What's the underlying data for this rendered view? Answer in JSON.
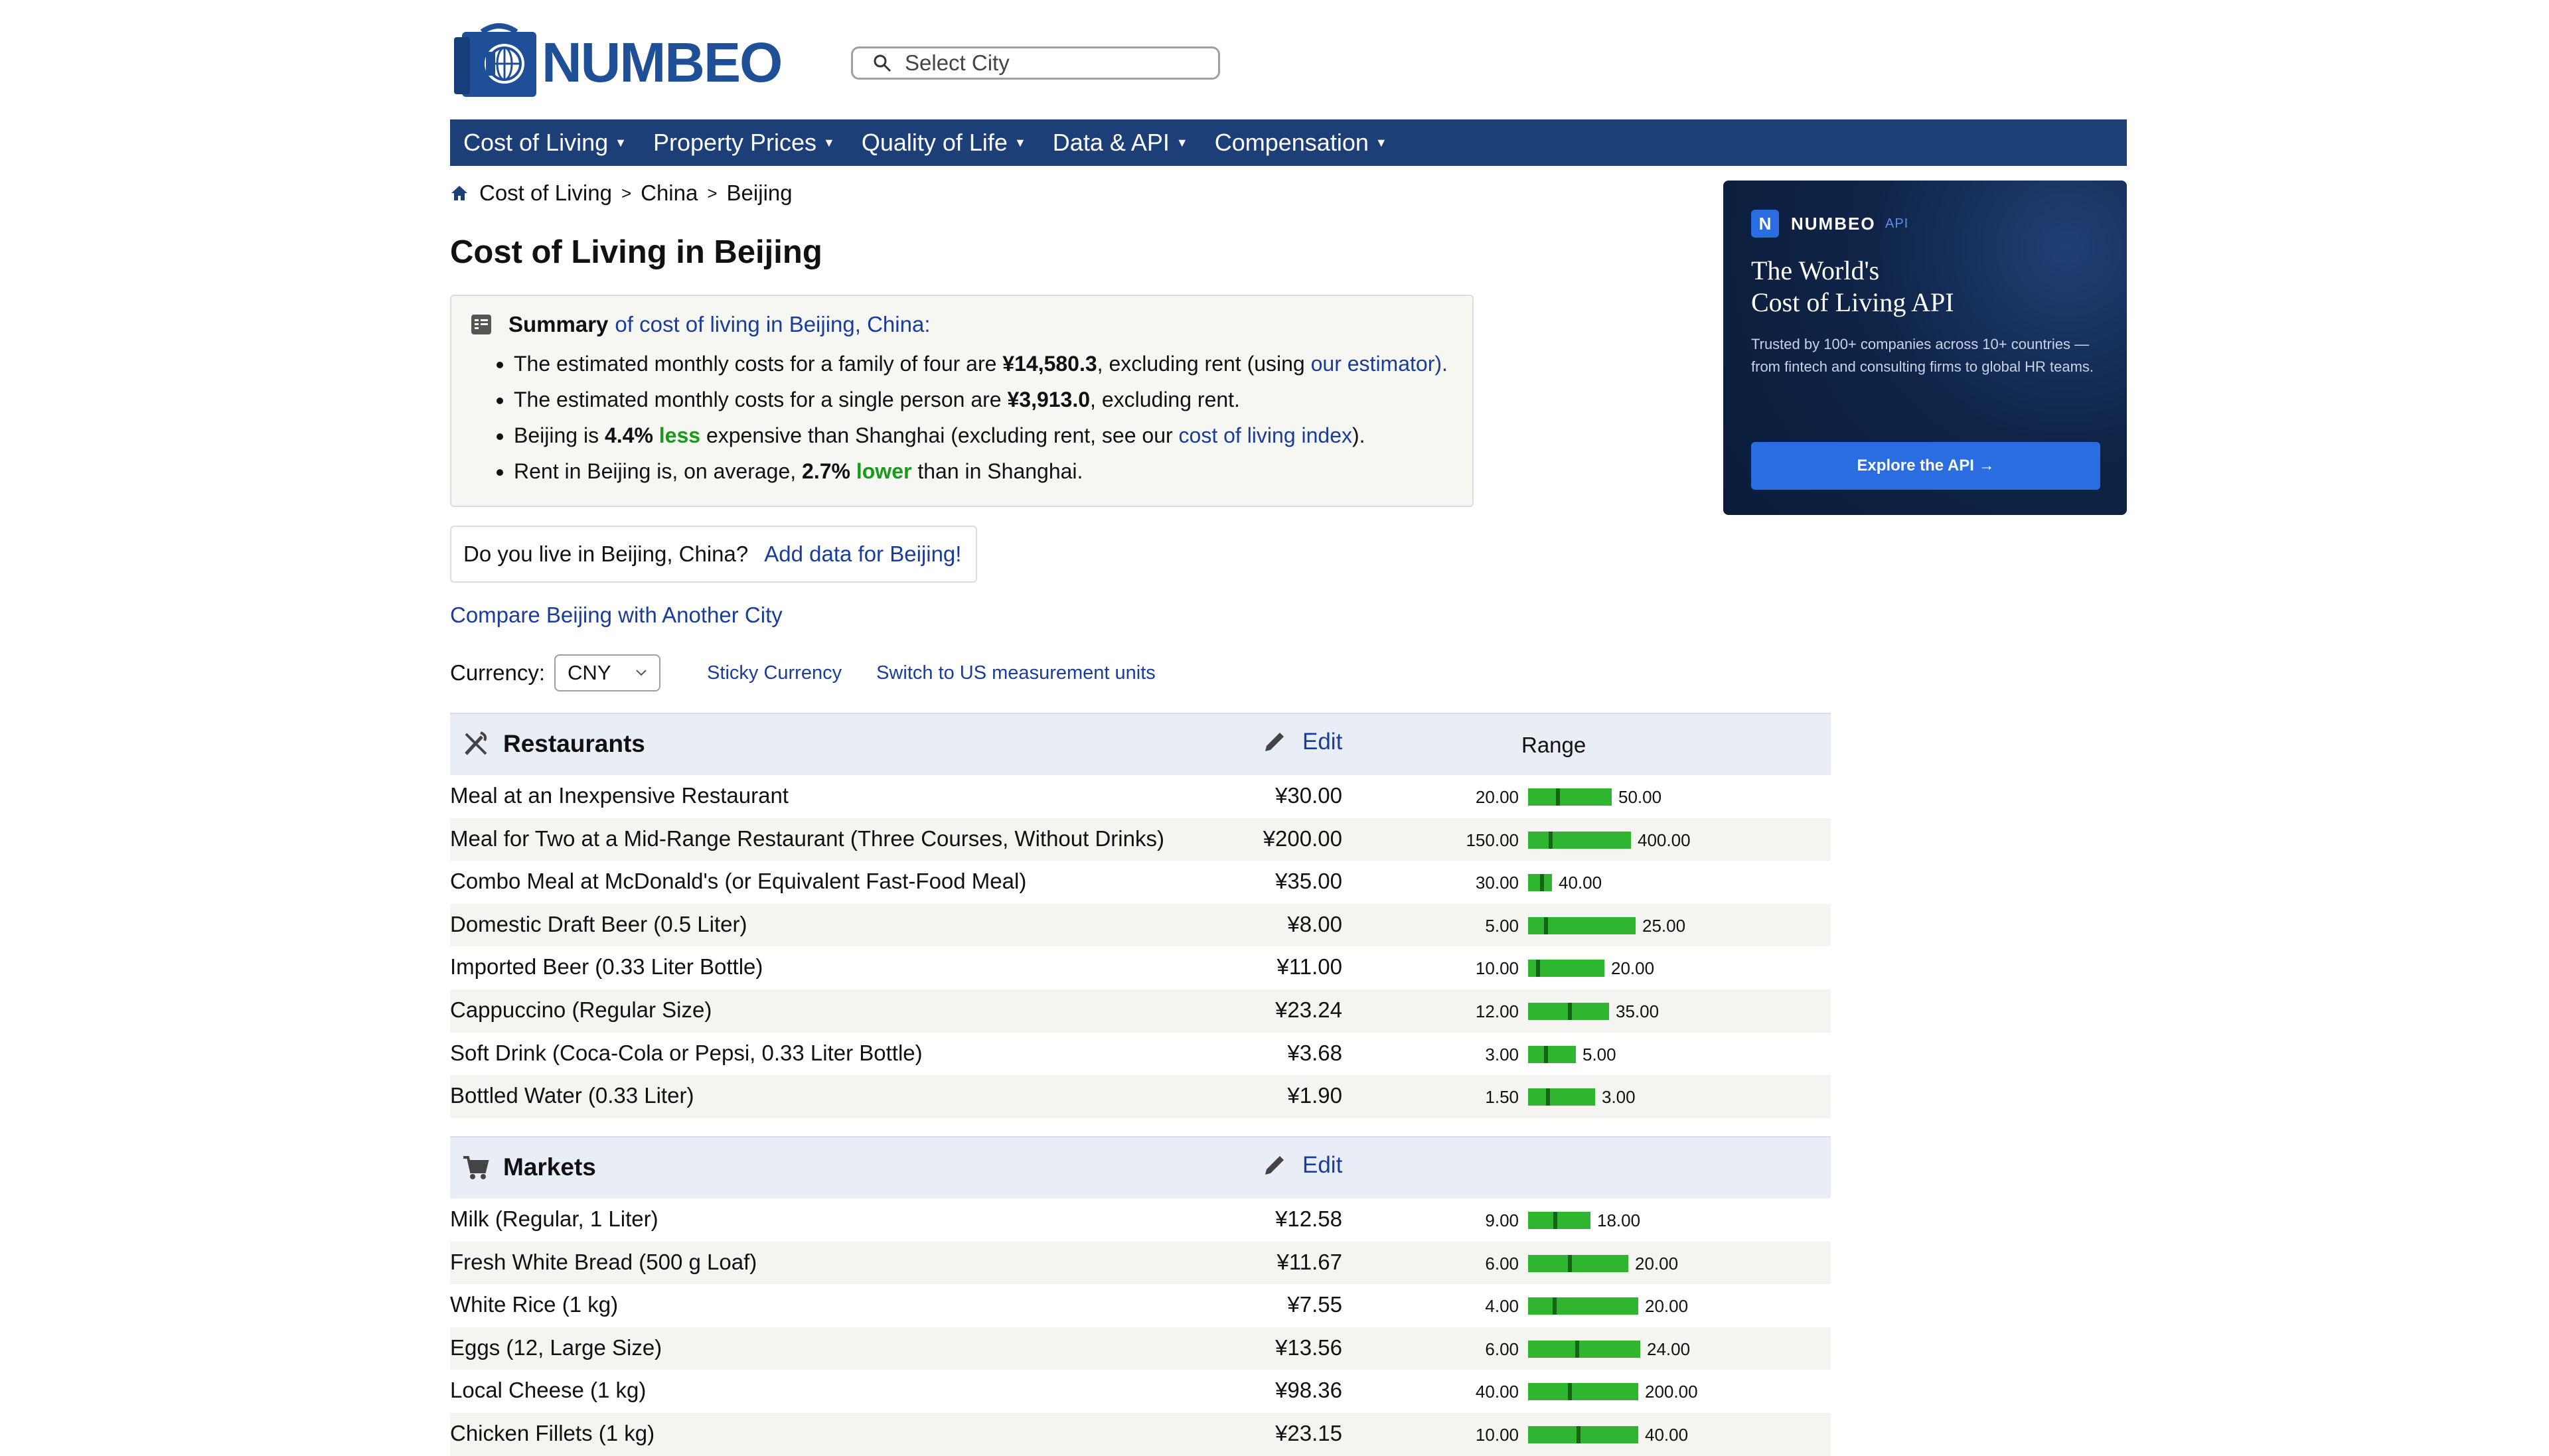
{
  "brand": {
    "name": "NUMBEO"
  },
  "search": {
    "placeholder": "Select City"
  },
  "nav": [
    {
      "label": "Cost of Living"
    },
    {
      "label": "Property Prices"
    },
    {
      "label": "Quality of Life"
    },
    {
      "label": "Data & API"
    },
    {
      "label": "Compensation"
    }
  ],
  "breadcrumb": {
    "item1": "Cost of Living",
    "item2": "China",
    "item3": "Beijing",
    "sep": ">"
  },
  "page_title": "Cost of Living in Beijing",
  "summary": {
    "label": "Summary",
    "intro": "of cost of living in Beijing, China:",
    "b1_pre": "The estimated monthly costs for a family of four are ",
    "b1_value": "¥14,580.3",
    "b1_mid": ", excluding rent (using ",
    "b1_link": "our estimator",
    "b1_post": ").",
    "b2_pre": "The estimated monthly costs for a single person are ",
    "b2_value": "¥3,913.0",
    "b2_post": ", excluding rent.",
    "b3_pre": "Beijing is ",
    "b3_pct": "4.4%",
    "b3_word": "less",
    "b3_mid": " expensive than Shanghai (excluding rent, see our ",
    "b3_link": "cost of living index",
    "b3_post": ").",
    "b4_pre": "Rent in Beijing is, on average, ",
    "b4_pct": "2.7%",
    "b4_word": "lower",
    "b4_post": " than in Shanghai."
  },
  "live": {
    "question": "Do you live in Beijing, China?",
    "link": "Add data for Beijing!"
  },
  "compare_link": "Compare Beijing with Another City",
  "currency": {
    "label": "Currency:",
    "value": "CNY",
    "sticky": "Sticky Currency",
    "switch": "Switch to US measurement units"
  },
  "ad": {
    "badge": "N",
    "brand": "NUMBEO",
    "tag": "API",
    "title_line1": "The World's",
    "title_line2": "Cost of Living API",
    "text": "Trusted by 100+ companies across 10+ countries — from fintech and consulting firms to global HR teams.",
    "button": "Explore the API →"
  },
  "restaurants": {
    "title": "Restaurants",
    "edit": "Edit",
    "range": "Range",
    "rows": [
      {
        "name": "Meal at an Inexpensive Restaurant",
        "price": "¥30.00",
        "min": "20.00",
        "max": "50.00",
        "bar_len": 0.35,
        "tick": 0.33
      },
      {
        "name": "Meal for Two at a Mid-Range Restaurant (Three Courses, Without Drinks)",
        "price": "¥200.00",
        "min": "150.00",
        "max": "400.00",
        "bar_len": 0.43,
        "tick": 0.2
      },
      {
        "name": "Combo Meal at McDonald's (or Equivalent Fast-Food Meal)",
        "price": "¥35.00",
        "min": "30.00",
        "max": "40.00",
        "bar_len": 0.1,
        "tick": 0.5
      },
      {
        "name": "Domestic Draft Beer (0.5 Liter)",
        "price": "¥8.00",
        "min": "5.00",
        "max": "25.00",
        "bar_len": 0.45,
        "tick": 0.15
      },
      {
        "name": "Imported Beer (0.33 Liter Bottle)",
        "price": "¥11.00",
        "min": "10.00",
        "max": "20.00",
        "bar_len": 0.32,
        "tick": 0.1
      },
      {
        "name": "Cappuccino (Regular Size)",
        "price": "¥23.24",
        "min": "12.00",
        "max": "35.00",
        "bar_len": 0.34,
        "tick": 0.49
      },
      {
        "name": "Soft Drink (Coca-Cola or Pepsi, 0.33 Liter Bottle)",
        "price": "¥3.68",
        "min": "3.00",
        "max": "5.00",
        "bar_len": 0.2,
        "tick": 0.34
      },
      {
        "name": "Bottled Water (0.33 Liter)",
        "price": "¥1.90",
        "min": "1.50",
        "max": "3.00",
        "bar_len": 0.28,
        "tick": 0.27
      }
    ]
  },
  "markets": {
    "title": "Markets",
    "edit": "Edit",
    "rows": [
      {
        "name": "Milk (Regular, 1 Liter)",
        "price": "¥12.58",
        "min": "9.00",
        "max": "18.00",
        "bar_len": 0.26,
        "tick": 0.4
      },
      {
        "name": "Fresh White Bread (500 g Loaf)",
        "price": "¥11.67",
        "min": "6.00",
        "max": "20.00",
        "bar_len": 0.42,
        "tick": 0.4
      },
      {
        "name": "White Rice (1 kg)",
        "price": "¥7.55",
        "min": "4.00",
        "max": "20.00",
        "bar_len": 0.46,
        "tick": 0.22
      },
      {
        "name": "Eggs (12, Large Size)",
        "price": "¥13.56",
        "min": "6.00",
        "max": "24.00",
        "bar_len": 0.47,
        "tick": 0.42
      },
      {
        "name": "Local Cheese (1 kg)",
        "price": "¥98.36",
        "min": "40.00",
        "max": "200.00",
        "bar_len": 0.46,
        "tick": 0.36
      },
      {
        "name": "Chicken Fillets (1 kg)",
        "price": "¥23.15",
        "min": "10.00",
        "max": "40.00",
        "bar_len": 0.46,
        "tick": 0.44
      }
    ]
  },
  "colors": {
    "nav": "#1c3f78",
    "link": "#1a3c9a",
    "bar": "#2fb52f",
    "tick": "#146614",
    "highlight": "#1a9a1a"
  }
}
